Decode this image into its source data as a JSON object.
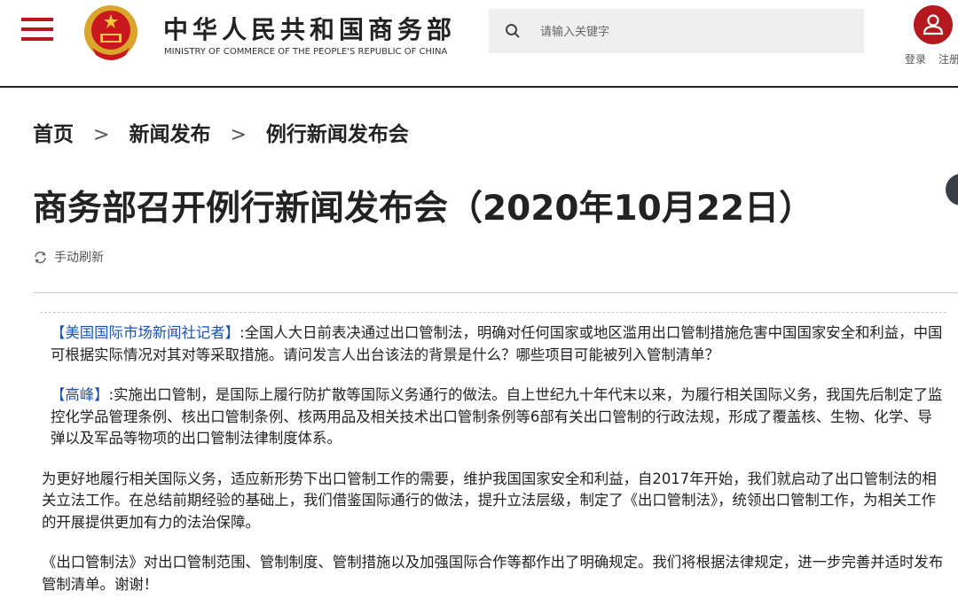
{
  "header": {
    "site_title": "中华人民共和国商务部",
    "site_subtitle": "MINISTRY OF COMMERCE OF THE PEOPLE'S REPUBLIC OF CHINA",
    "search_placeholder": "请输入关键字",
    "login": "登录",
    "register": "注册"
  },
  "breadcrumb": [
    "首页",
    "新闻发布",
    "例行新闻发布会"
  ],
  "title": "商务部召开例行新闻发布会（2020年10月22日）",
  "refresh_label": "手动刷新",
  "paragraphs": [
    {
      "speaker": "【美国国际市场新闻社记者】",
      "text": ":全国人大日前表决通过出口管制法，明确对任何国家或地区滥用出口管制措施危害中国国家安全和利益，中国可根据实际情况对其对等采取措施。请问发言人出台该法的背景是什么？哪些项目可能被列入管制清单？"
    },
    {
      "speaker": "【高峰】",
      "text": ":实施出口管制，是国际上履行防扩散等国际义务通行的做法。自上世纪九十年代末以来，为履行相关国际义务，我国先后制定了监控化学品管理条例、核出口管制条例、核两用品及相关技术出口管制条例等6部有关出口管制的行政法规，形成了覆盖核、生物、化学、导弹以及军品等物项的出口管制法律制度体系。"
    },
    {
      "speaker": "",
      "text": "为更好地履行相关国际义务，适应新形势下出口管制工作的需要，维护我国国家安全和利益，自2017年开始，我们就启动了出口管制法的相关立法工作。在总结前期经验的基础上，我们借鉴国际通行的做法，提升立法层级，制定了《出口管制法》，统领出口管制工作，为相关工作的开展提供更加有力的法治保障。"
    },
    {
      "speaker": "",
      "text": "《出口管制法》对出口管制范围、管制制度、管制措施以及加强国际合作等都作出了明确规定。我们将根据法律规定，进一步完善并适时发布管制清单。谢谢！"
    }
  ],
  "colors": {
    "brand_red": "#b3191e",
    "speaker_blue": "#1a54b3"
  }
}
